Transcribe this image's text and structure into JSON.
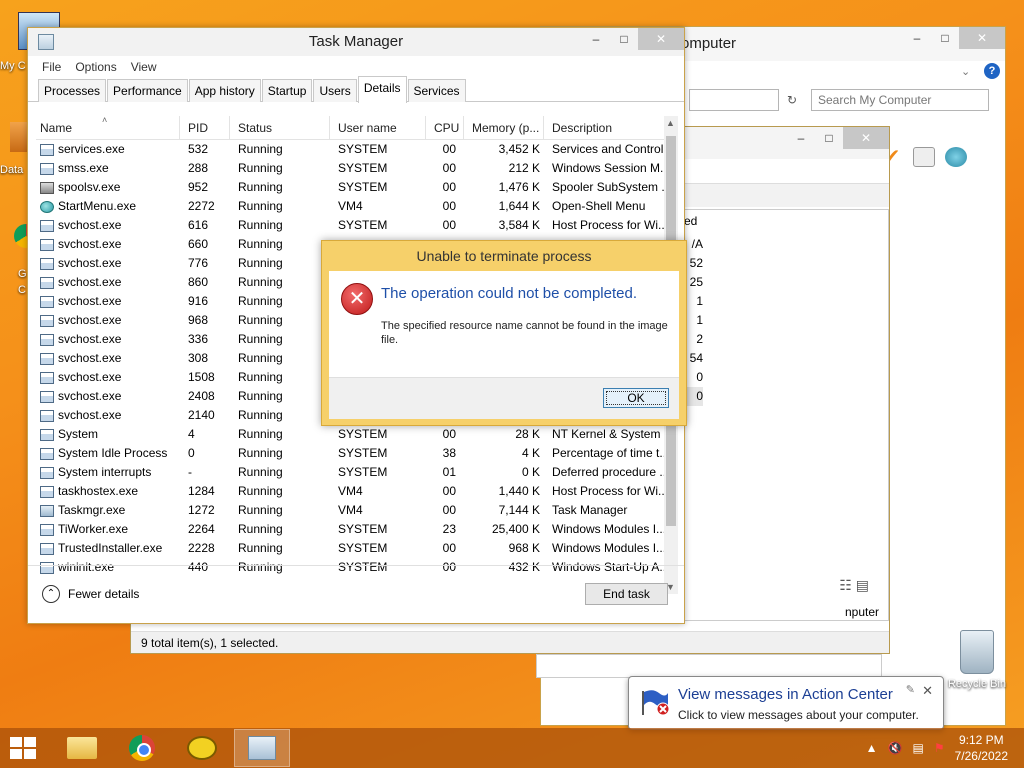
{
  "desktop": {
    "left_labels": [
      "My C",
      "Data",
      "G",
      "C"
    ],
    "recycle_bin_label": "Recycle Bin"
  },
  "bg_window": {
    "title": "omputer",
    "search_placeholder": "Search My Computer"
  },
  "mid_window": {
    "status": "9 total item(s), 1 selected.",
    "column_header": "sed",
    "values": [
      "/A",
      "52",
      "25",
      "1",
      "1",
      "2",
      "54",
      "0",
      "0"
    ],
    "bottom_label": "nputer"
  },
  "task_manager": {
    "title": "Task Manager",
    "menu": [
      "File",
      "Options",
      "View"
    ],
    "tabs": [
      "Processes",
      "Performance",
      "App history",
      "Startup",
      "Users",
      "Details",
      "Services"
    ],
    "active_tab": "Details",
    "columns": [
      "Name",
      "PID",
      "Status",
      "User name",
      "CPU",
      "Memory (p...",
      "Description"
    ],
    "rows": [
      {
        "icon": "window",
        "name": "services.exe",
        "pid": "532",
        "status": "Running",
        "user": "SYSTEM",
        "cpu": "00",
        "mem": "3,452 K",
        "desc": "Services and Control..."
      },
      {
        "icon": "window",
        "name": "smss.exe",
        "pid": "288",
        "status": "Running",
        "user": "SYSTEM",
        "cpu": "00",
        "mem": "212 K",
        "desc": "Windows Session M..."
      },
      {
        "icon": "printer",
        "name": "spoolsv.exe",
        "pid": "952",
        "status": "Running",
        "user": "SYSTEM",
        "cpu": "00",
        "mem": "1,476 K",
        "desc": "Spooler SubSystem ..."
      },
      {
        "icon": "globe",
        "name": "StartMenu.exe",
        "pid": "2272",
        "status": "Running",
        "user": "VM4",
        "cpu": "00",
        "mem": "1,644 K",
        "desc": "Open-Shell Menu"
      },
      {
        "icon": "window",
        "name": "svchost.exe",
        "pid": "616",
        "status": "Running",
        "user": "SYSTEM",
        "cpu": "00",
        "mem": "3,584 K",
        "desc": "Host Process for Wi..."
      },
      {
        "icon": "window",
        "name": "svchost.exe",
        "pid": "660",
        "status": "Running",
        "user": "",
        "cpu": "",
        "mem": "",
        "desc": ""
      },
      {
        "icon": "window",
        "name": "svchost.exe",
        "pid": "776",
        "status": "Running",
        "user": "",
        "cpu": "",
        "mem": "",
        "desc": ""
      },
      {
        "icon": "window",
        "name": "svchost.exe",
        "pid": "860",
        "status": "Running",
        "user": "",
        "cpu": "",
        "mem": "",
        "desc": ""
      },
      {
        "icon": "window",
        "name": "svchost.exe",
        "pid": "916",
        "status": "Running",
        "user": "",
        "cpu": "",
        "mem": "",
        "desc": ""
      },
      {
        "icon": "window",
        "name": "svchost.exe",
        "pid": "968",
        "status": "Running",
        "user": "",
        "cpu": "",
        "mem": "",
        "desc": ""
      },
      {
        "icon": "window",
        "name": "svchost.exe",
        "pid": "336",
        "status": "Running",
        "user": "",
        "cpu": "",
        "mem": "",
        "desc": ""
      },
      {
        "icon": "window",
        "name": "svchost.exe",
        "pid": "308",
        "status": "Running",
        "user": "",
        "cpu": "",
        "mem": "",
        "desc": ""
      },
      {
        "icon": "window",
        "name": "svchost.exe",
        "pid": "1508",
        "status": "Running",
        "user": "",
        "cpu": "",
        "mem": "",
        "desc": ""
      },
      {
        "icon": "window",
        "name": "svchost.exe",
        "pid": "2408",
        "status": "Running",
        "user": "",
        "cpu": "",
        "mem": "",
        "desc": ""
      },
      {
        "icon": "window",
        "name": "svchost.exe",
        "pid": "2140",
        "status": "Running",
        "user": "",
        "cpu": "",
        "mem": "",
        "desc": ""
      },
      {
        "icon": "window",
        "name": "System",
        "pid": "4",
        "status": "Running",
        "user": "SYSTEM",
        "cpu": "00",
        "mem": "28 K",
        "desc": "NT Kernel & System"
      },
      {
        "icon": "window",
        "name": "System Idle Process",
        "pid": "0",
        "status": "Running",
        "user": "SYSTEM",
        "cpu": "38",
        "mem": "4 K",
        "desc": "Percentage of time t..."
      },
      {
        "icon": "window",
        "name": "System interrupts",
        "pid": "-",
        "status": "Running",
        "user": "SYSTEM",
        "cpu": "01",
        "mem": "0 K",
        "desc": "Deferred procedure ..."
      },
      {
        "icon": "window",
        "name": "taskhostex.exe",
        "pid": "1284",
        "status": "Running",
        "user": "VM4",
        "cpu": "00",
        "mem": "1,440 K",
        "desc": "Host Process for Wi..."
      },
      {
        "icon": "tm",
        "name": "Taskmgr.exe",
        "pid": "1272",
        "status": "Running",
        "user": "VM4",
        "cpu": "00",
        "mem": "7,144 K",
        "desc": "Task Manager"
      },
      {
        "icon": "window",
        "name": "TiWorker.exe",
        "pid": "2264",
        "status": "Running",
        "user": "SYSTEM",
        "cpu": "23",
        "mem": "25,400 K",
        "desc": "Windows Modules I..."
      },
      {
        "icon": "window",
        "name": "TrustedInstaller.exe",
        "pid": "2228",
        "status": "Running",
        "user": "SYSTEM",
        "cpu": "00",
        "mem": "968 K",
        "desc": "Windows Modules I..."
      },
      {
        "icon": "window",
        "name": "wininit.exe",
        "pid": "440",
        "status": "Running",
        "user": "SYSTEM",
        "cpu": "00",
        "mem": "432 K",
        "desc": "Windows Start-Up A..."
      }
    ],
    "fewer_details": "Fewer details",
    "end_task": "End task"
  },
  "error_dialog": {
    "title": "Unable to terminate process",
    "main": "The operation could not be completed.",
    "sub": "The specified resource name cannot be found in the image file.",
    "ok": "OK"
  },
  "balloon": {
    "title": "View messages in Action Center",
    "text": "Click to view messages about your computer."
  },
  "tray": {
    "time": "9:12 PM",
    "date": "7/26/2022"
  }
}
